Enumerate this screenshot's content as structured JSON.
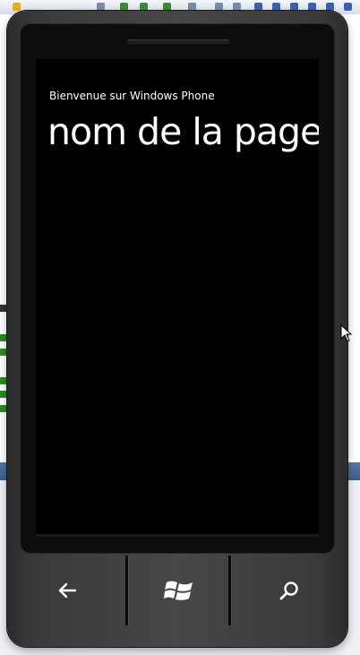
{
  "screen": {
    "app_title": "Bienvenue sur Windows Phone",
    "page_title": "nom de la page"
  },
  "hardware_buttons": [
    {
      "name": "back",
      "icon": "back-arrow-icon"
    },
    {
      "name": "start",
      "icon": "windows-logo-icon"
    },
    {
      "name": "search",
      "icon": "search-icon"
    }
  ],
  "colors": {
    "screen_background": "#000000",
    "text": "#ffffff",
    "phone_body": "#3a3a3a"
  }
}
